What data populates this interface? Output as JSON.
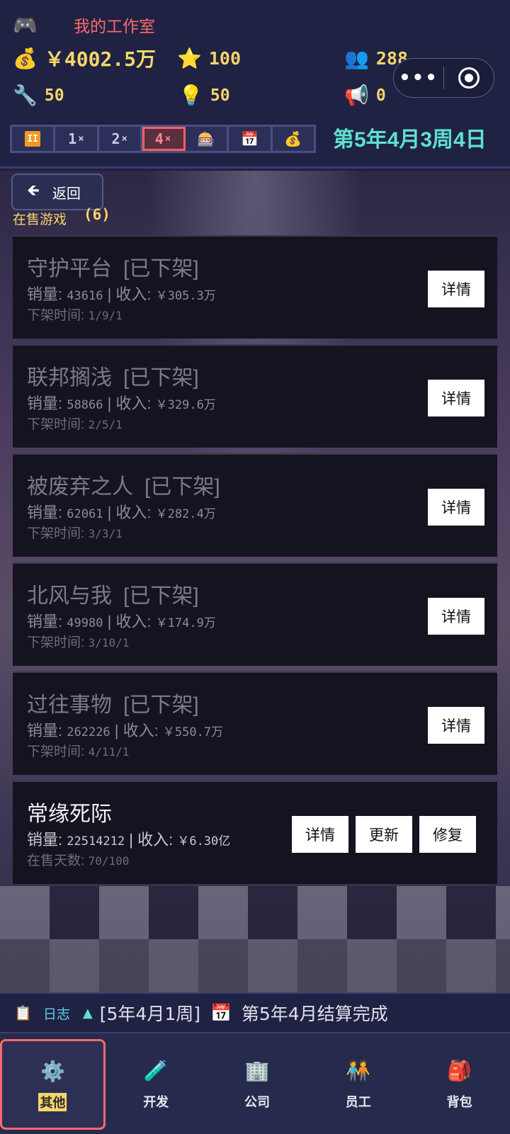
{
  "header": {
    "studio_name": "我的工作室",
    "stats": {
      "money": "￥4002.5万",
      "stars": "100",
      "staff": "288",
      "tools": "50",
      "ideas": "50",
      "promo": "0"
    },
    "speed": {
      "pause_icon": "II",
      "x1": "1",
      "x2": "2",
      "x4": "4",
      "x_suffix": "×",
      "active": "4x"
    },
    "date": "第5年4月3周4日"
  },
  "capsule": {
    "more": "•••"
  },
  "main": {
    "back_label": "返回",
    "section_label": "在售游戏",
    "section_count": "(6)",
    "games": [
      {
        "name": "守护平台",
        "tag": "[已下架]",
        "stats_prefix": "销量:",
        "sales": "43616",
        "revenue_prefix": "| 收入: ",
        "revenue": "￥305.3万",
        "sub_label": "下架时间:",
        "sub_value": "1/9/1",
        "active": false
      },
      {
        "name": "联邦搁浅",
        "tag": "[已下架]",
        "stats_prefix": "销量:",
        "sales": "58866",
        "revenue_prefix": "| 收入: ",
        "revenue": "￥329.6万",
        "sub_label": "下架时间:",
        "sub_value": "2/5/1",
        "active": false
      },
      {
        "name": "被废弃之人",
        "tag": "[已下架]",
        "stats_prefix": "销量:",
        "sales": "62061",
        "revenue_prefix": "| 收入: ",
        "revenue": "￥282.4万",
        "sub_label": "下架时间:",
        "sub_value": "3/3/1",
        "active": false
      },
      {
        "name": "北风与我",
        "tag": "[已下架]",
        "stats_prefix": "销量:",
        "sales": "49980",
        "revenue_prefix": "| 收入: ",
        "revenue": "￥174.9万",
        "sub_label": "下架时间:",
        "sub_value": "3/10/1",
        "active": false
      },
      {
        "name": "过往事物",
        "tag": "[已下架]",
        "stats_prefix": "销量:",
        "sales": "262226",
        "revenue_prefix": "| 收入: ",
        "revenue": "￥550.7万",
        "sub_label": "下架时间:",
        "sub_value": "4/11/1",
        "active": false
      },
      {
        "name": "常缘死际",
        "tag": "",
        "stats_prefix": "销量:",
        "sales": "22514212",
        "revenue_prefix": "| 收入: ",
        "revenue": "￥6.30亿",
        "sub_label": "在售天数:",
        "sub_value": "70/100",
        "active": true
      }
    ],
    "buttons": {
      "detail": "详情",
      "update": "更新",
      "repair": "修复"
    }
  },
  "log": {
    "label": "日志",
    "date": "[5年4月1周]",
    "text": "第5年4月结算完成"
  },
  "nav": {
    "items": [
      {
        "label": "其他",
        "icon": "gear-icon"
      },
      {
        "label": "开发",
        "icon": "flask-icon"
      },
      {
        "label": "公司",
        "icon": "building-icon"
      },
      {
        "label": "员工",
        "icon": "staff-icon"
      },
      {
        "label": "背包",
        "icon": "backpack-icon"
      }
    ],
    "active": "其他"
  }
}
